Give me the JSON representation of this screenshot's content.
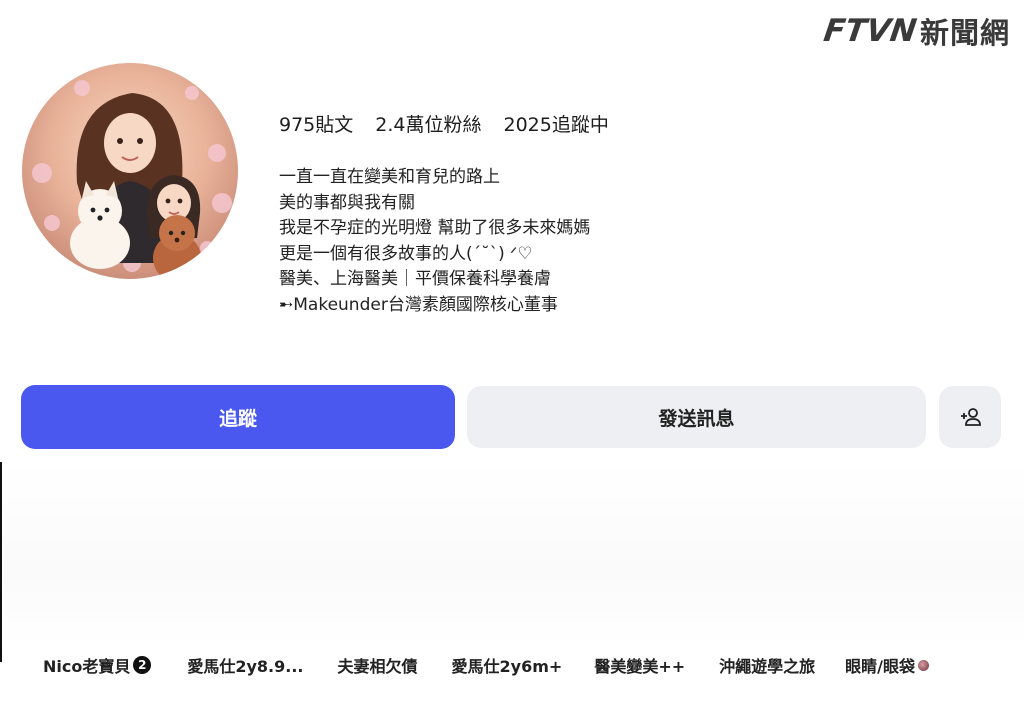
{
  "watermark": {
    "latin": "FTVN",
    "cjk": "新聞網"
  },
  "profile": {
    "avatar_icon": "illustrated-mother-daughter-dogs-avatar",
    "stats": {
      "posts": "975貼文",
      "followers": "2.4萬位粉絲",
      "following": "2025追蹤中"
    },
    "bio_lines": [
      "一直一直在變美和育兒的路上",
      "美的事都與我有關",
      "我是不孕症的光明燈 幫助了很多未來媽媽",
      "更是一個有很多故事的人(ˊ˘ˋ) ᐟ♡",
      "醫美、上海醫美｜平價保養科學養膚",
      "➸Makeunder台灣素顏國際核心董事"
    ]
  },
  "actions": {
    "follow_label": "追蹤",
    "message_label": "發送訊息",
    "add_user_icon": "add-person-icon",
    "follow_color": "#4b58f0",
    "secondary_color": "#eeeff2"
  },
  "highlights": [
    {
      "label": "Nico老寶貝",
      "badge": "2"
    },
    {
      "label": "愛馬仕2y8.9..."
    },
    {
      "label": "夫妻相欠債"
    },
    {
      "label": "愛馬仕2y6m+"
    },
    {
      "label": "醫美變美++"
    },
    {
      "label": "沖繩遊學之旅"
    },
    {
      "label": "眼睛/眼袋"
    }
  ]
}
